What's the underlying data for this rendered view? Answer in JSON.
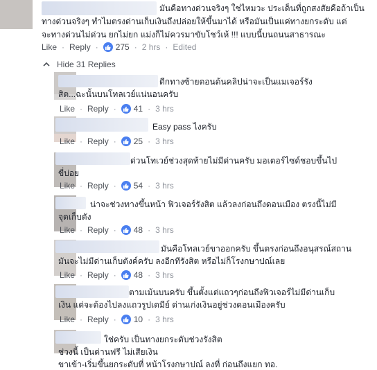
{
  "main_comment": {
    "lines": [
      "มันคือทางด่วนจริงๆ ใช่ไหมวะ ประเด็นที่ถูกสงสัยคือถ้าเป็น",
      "ทางด่วนจริงๆ ทำไมตรงด่านเก็บเงินถึงปล่อยให้ขึ้นมาได้ หรือมันเป็นแค่ทางยกระดับ แต่",
      "จะทางด่วนไม่ด่วน ยกไม่ยก แม่งก็ไม่ควรมาขับโชว์เห้ !!! แบบนี้บนถนนสาธารณะ"
    ],
    "like": "Like",
    "reply": "Reply",
    "likes": "275",
    "time": "2 hrs",
    "edited": "Edited"
  },
  "hide_replies_label": "Hide 31 Replies",
  "replies": [
    {
      "lines": [
        "ดีกทางซ้ายตอนต้นคลิปน่าจะเป็นแมเจอร์รัง",
        "สิต...ฉะนั้นบนโทลเวย์แน่นอนครับ"
      ],
      "like": "Like",
      "reply": "Reply",
      "likes": "41",
      "time": "3 hrs"
    },
    {
      "lines": [
        "Easy pass ไงครับ"
      ],
      "like": "Like",
      "reply": "Reply",
      "likes": "25",
      "time": "3 hrs"
    },
    {
      "lines": [
        "ด่วนโทเวย์ช่วงสุดท้ายไม่มีด่านครับ มอเตอร์ไซด์ชอบขึ้นไป",
        "ขี่บ่อย"
      ],
      "like": "Like",
      "reply": "Reply",
      "likes": "54",
      "time": "3 hrs"
    },
    {
      "lines": [
        "น่าจะช่วงทางขึ้นหน้า ฟิวเจอร์รังสิต แล้วลงก่อนถึงดอนเมือง ตรงนี้ไม่มี",
        "จุดเก็บตัง"
      ],
      "like": "Like",
      "reply": "Reply",
      "likes": "48",
      "time": "3 hrs"
    },
    {
      "lines": [
        "มันคือโทลเวย์ขาออกครับ ขึ้นตรงก่อนถึงอนุสรณ์สถาน",
        "มันจะไม่มีด่านเก็บตังค์ครับ ลงอีกทีรังสิต หรือไม่ก็โรงกษาปณ์เลย"
      ],
      "like": "Like",
      "reply": "Reply",
      "likes": "48",
      "time": "3 hrs"
    },
    {
      "lines": [
        "ตามเม้นบนครับ ขึ้นตั้งแต่แถวๆก่อนถึงฟิวเจอร์ไม่มีด่านเก็บ",
        "เงิน แต่จะต้องไปลงแถวรูปเตมีย์ ด่านเก่งเงินอยู่ช่วงดอนเมืองครับ"
      ],
      "like": "Like",
      "reply": "Reply",
      "likes": "10",
      "time": "3 hrs"
    },
    {
      "lines": [
        "ใช่ครับ เป็นทางยกระดับช่วงรังสิต",
        "ช่วงนี้ เป็นด่านฟรี ไม่เสียเงิน",
        "ขาเข้า-เริ่มขึ้นยกระดับที่ หน้าโรงกษาปณ์ ลงที่ ก่อนถึงแยก ทอ."
      ]
    }
  ],
  "colors": {
    "link": "#4b4f56",
    "muted": "#90949c",
    "like_badge": "#4a7ff0",
    "blurred_name": "#d7deed"
  },
  "icons": {
    "like_badge": "thumbs-up-icon",
    "hide_toggle": "chevron-up-icon"
  }
}
